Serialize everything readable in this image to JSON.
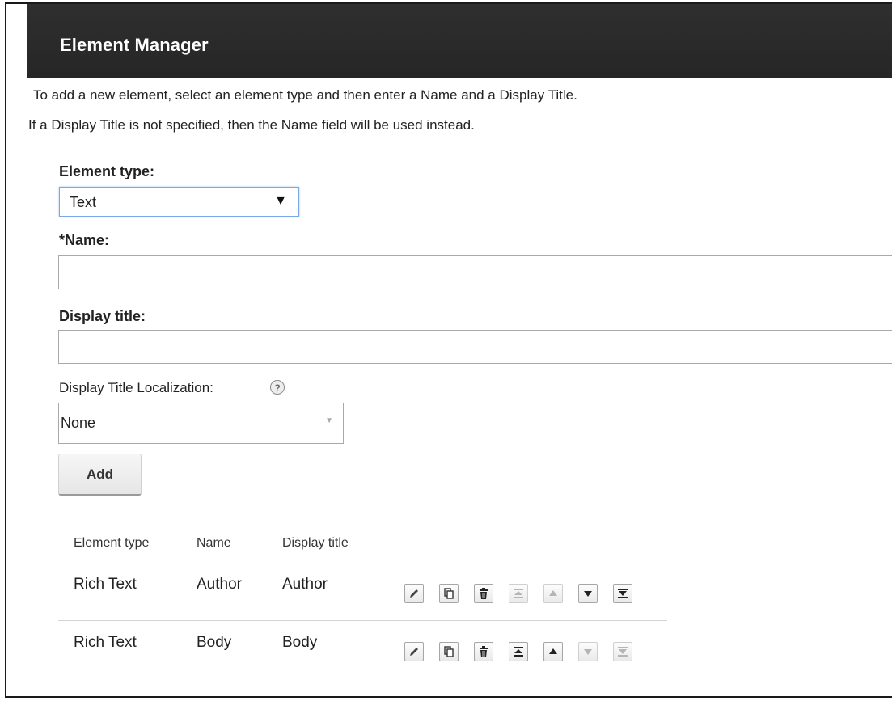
{
  "header": {
    "title": "Element Manager"
  },
  "instructions": {
    "line1": "To add a new element, select an element type and then enter a Name and a Display Title.",
    "line2": "If a Display Title is not specified, then the Name field will be used instead."
  },
  "form": {
    "element_type_label": "Element type:",
    "element_type_value": "Text",
    "name_label": "*Name:",
    "name_value": "",
    "display_title_label": "Display title:",
    "display_title_value": "",
    "localization_label": "Display Title Localization:",
    "localization_value": "None",
    "add_label": "Add"
  },
  "table": {
    "headers": [
      "Element type",
      "Name",
      "Display title"
    ],
    "rows": [
      {
        "type": "Rich Text",
        "name": "Author",
        "title": "Author"
      },
      {
        "type": "Rich Text",
        "name": "Body",
        "title": "Body"
      }
    ]
  },
  "icons": {
    "edit": "pencil-icon",
    "copy": "copy-icon",
    "delete": "trash-icon",
    "move_top": "move-to-top-icon",
    "move_up": "move-up-icon",
    "move_down": "move-down-icon",
    "move_bottom": "move-to-bottom-icon"
  }
}
